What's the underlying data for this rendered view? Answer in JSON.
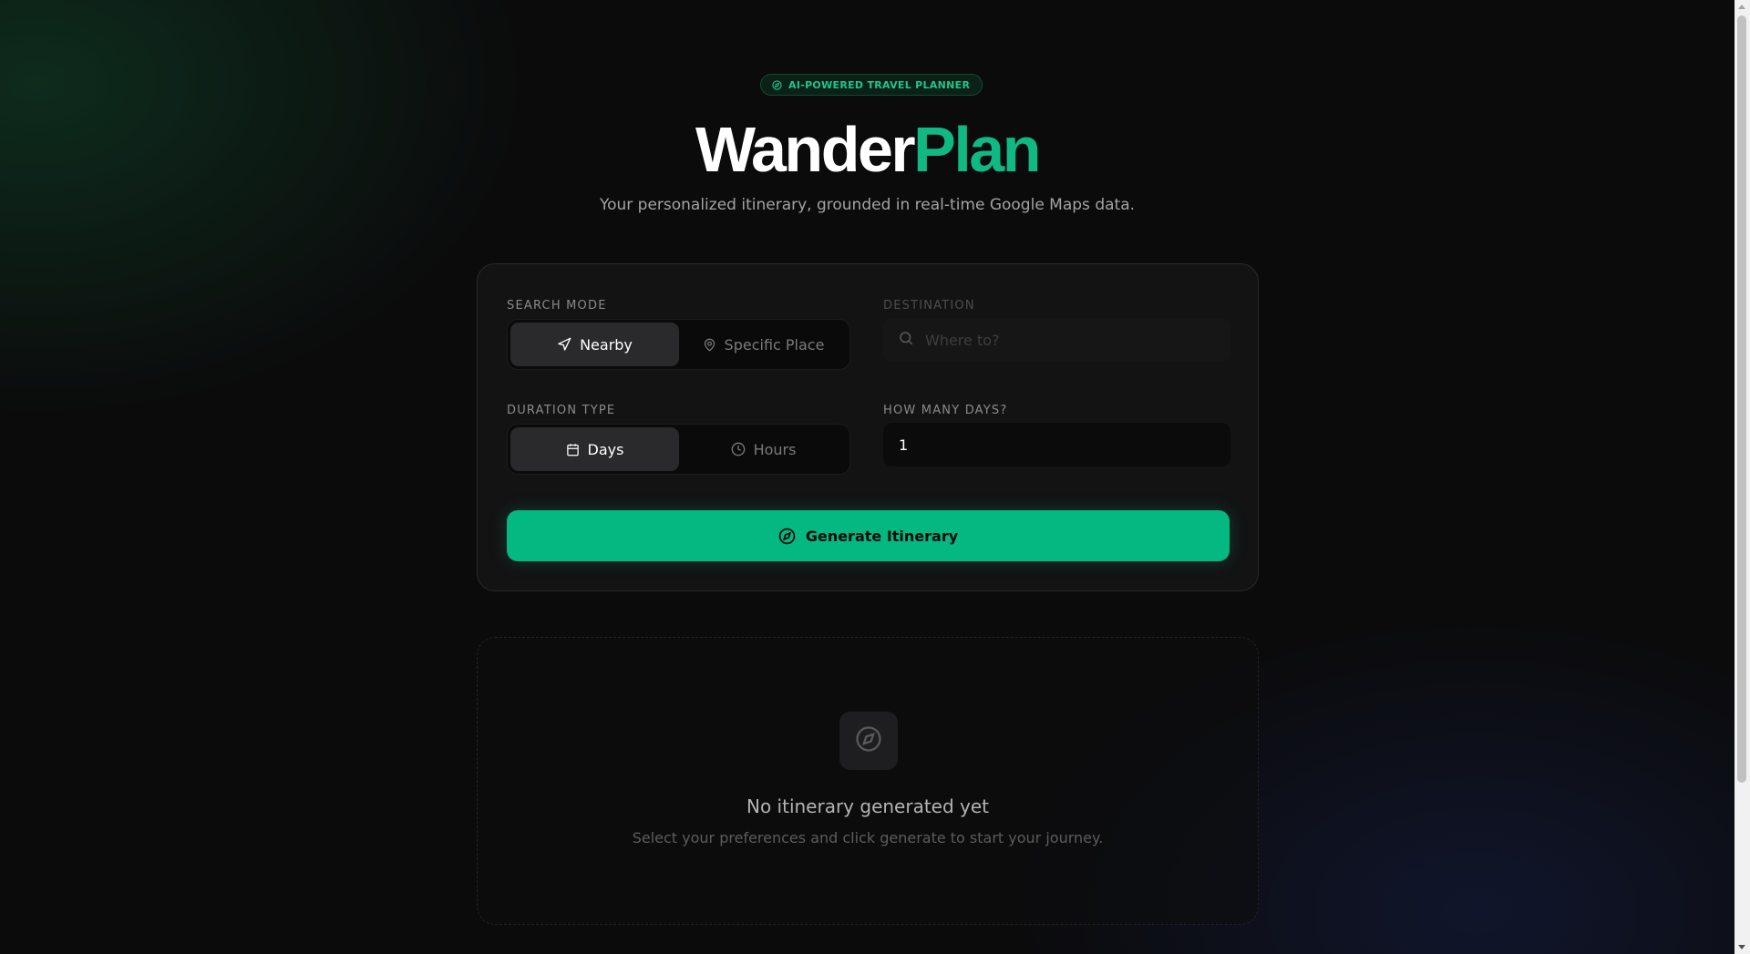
{
  "header": {
    "badge_label": "AI-POWERED TRAVEL PLANNER",
    "title_main": "Wander",
    "title_accent": "Plan",
    "subtitle": "Your personalized itinerary, grounded in real-time Google Maps data."
  },
  "form": {
    "search_mode": {
      "label": "SEARCH MODE",
      "options": [
        {
          "label": "Nearby",
          "icon": "navigation-arrow-icon",
          "active": true
        },
        {
          "label": "Specific Place",
          "icon": "map-pin-icon",
          "active": false
        }
      ]
    },
    "destination": {
      "label": "DESTINATION",
      "placeholder": "Where to?",
      "value": "",
      "disabled": true,
      "icon": "search-icon"
    },
    "duration_type": {
      "label": "DURATION TYPE",
      "options": [
        {
          "label": "Days",
          "icon": "calendar-icon",
          "active": true
        },
        {
          "label": "Hours",
          "icon": "clock-icon",
          "active": false
        }
      ]
    },
    "days": {
      "label": "HOW MANY DAYS?",
      "value": "1"
    },
    "generate_label": "Generate Itinerary"
  },
  "empty_state": {
    "title": "No itinerary generated yet",
    "subtitle": "Select your preferences and click generate to start your journey.",
    "icon": "compass-icon"
  },
  "colors": {
    "accent": "#10b981",
    "button": "#03b981",
    "background": "#0b0b0c",
    "card": "#131314"
  }
}
